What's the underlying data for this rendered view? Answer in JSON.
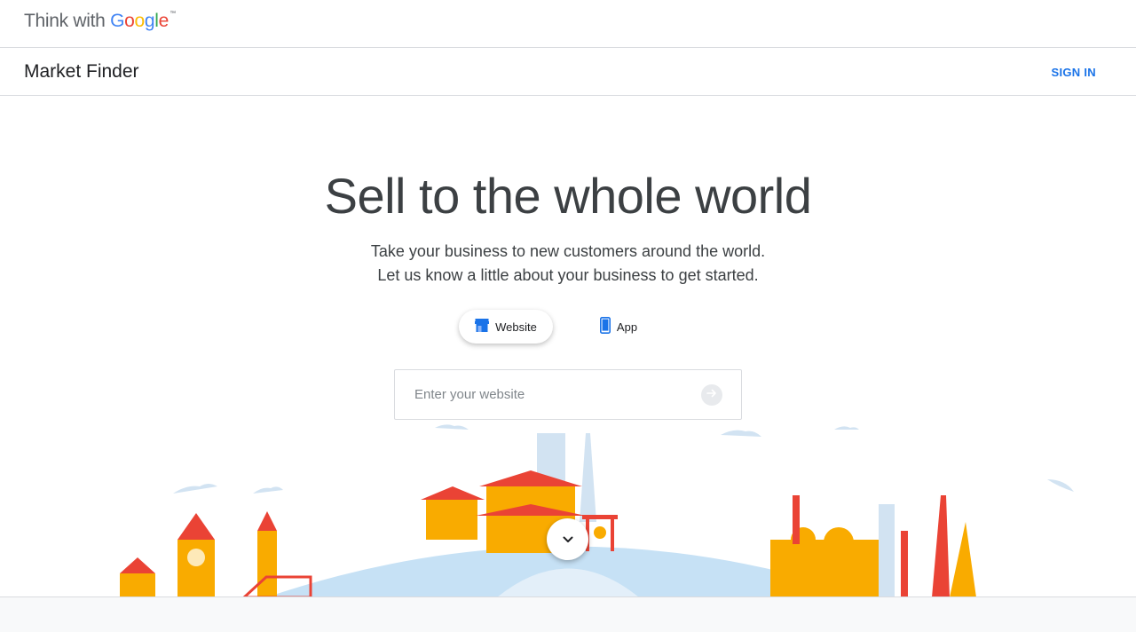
{
  "header": {
    "brand_prefix": "Think with",
    "brand_g1": "G",
    "brand_o1": "o",
    "brand_o2": "o",
    "brand_g2": "g",
    "brand_l": "l",
    "brand_e": "e",
    "brand_tm": "™"
  },
  "nav": {
    "app_title": "Market Finder",
    "signin_label": "SIGN IN"
  },
  "hero": {
    "title": "Sell to the whole world",
    "subtitle_line1": "Take your business to new customers around the world.",
    "subtitle_line2": "Let us know a little about your business to get started."
  },
  "toggles": {
    "website_label": "Website",
    "app_label": "App",
    "selected": "Website"
  },
  "search": {
    "placeholder": "Enter your website",
    "value": ""
  },
  "icons": {
    "website": "storefront-icon",
    "app": "smartphone-icon",
    "submit": "arrow-right-icon",
    "scroll": "chevron-down-icon"
  },
  "colors": {
    "accent": "#1a73e8",
    "google_blue": "#4285f4",
    "google_red": "#ea4335",
    "google_yellow": "#fbbc05",
    "google_green": "#34a853",
    "illustration_orange": "#f9ab00",
    "illustration_red": "#ea4335",
    "illustration_sky": "#c6e1f5"
  }
}
